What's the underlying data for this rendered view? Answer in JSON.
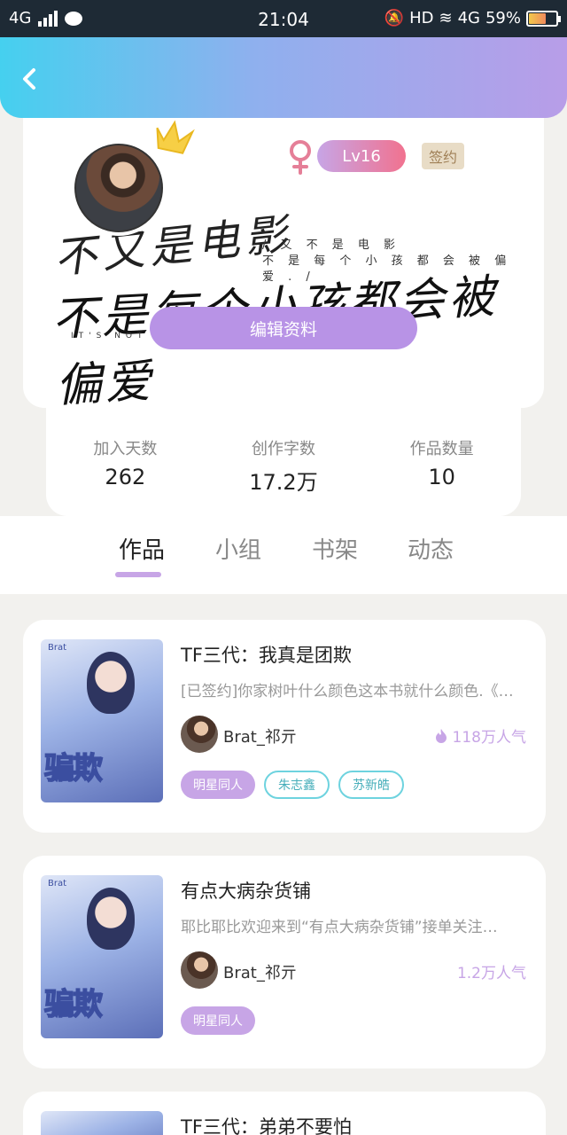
{
  "status_bar": {
    "network": "4G",
    "time": "21:04",
    "hd": "HD",
    "network_right": "4G",
    "battery": "59%"
  },
  "profile": {
    "signature_line1": "不又是电影",
    "signature_line2": "不是每个小孩都会被偏爱",
    "signature_small_1": "/ 又 不 是 电 影",
    "signature_small_2": "不 是 每 个 小 孩 都 会 被 偏 爱 . /",
    "signature_en": "IT'S NOT ... S FAVORED.",
    "level": "Lv16",
    "signed_label": "签约",
    "edit_button": "编辑资料"
  },
  "stats": [
    {
      "label": "加入天数",
      "value": "262"
    },
    {
      "label": "创作字数",
      "value": "17.2万"
    },
    {
      "label": "作品数量",
      "value": "10"
    }
  ],
  "tabs": [
    {
      "label": "作品",
      "active": true
    },
    {
      "label": "小组",
      "active": false
    },
    {
      "label": "书架",
      "active": false
    },
    {
      "label": "动态",
      "active": false
    }
  ],
  "works": [
    {
      "title": "TF三代：我真是团欺",
      "description": "[已签约]你家树叶什么颜色这本书就什么颜色.《李…",
      "author": "Brat_祁亓",
      "popularity": "118万人气",
      "cover_title": "骗欺",
      "tags": [
        {
          "label": "明星同人",
          "style": "filled"
        },
        {
          "label": "朱志鑫",
          "style": "outline"
        },
        {
          "label": "苏新皓",
          "style": "outline"
        }
      ]
    },
    {
      "title": "有点大病杂货铺",
      "description": "耶比耶比欢迎来到“有点大病杂货铺”接单关注…",
      "author": "Brat_祁亓",
      "popularity": "1.2万人气",
      "cover_title": "骗欺",
      "tags": [
        {
          "label": "明星同人",
          "style": "filled"
        }
      ]
    },
    {
      "title": "TF三代：弟弟不要怕"
    }
  ],
  "icons": {
    "back": "chevron-left-icon",
    "gender": "female-icon",
    "crown": "crown-icon",
    "flame": "flame-icon"
  },
  "colors": {
    "header_gradient_start": "#45d0ef",
    "header_gradient_end": "#b89de8",
    "accent_purple": "#c7a5e6",
    "level_gradient_end": "#f1728f",
    "tag_outline": "#6ed3df"
  }
}
